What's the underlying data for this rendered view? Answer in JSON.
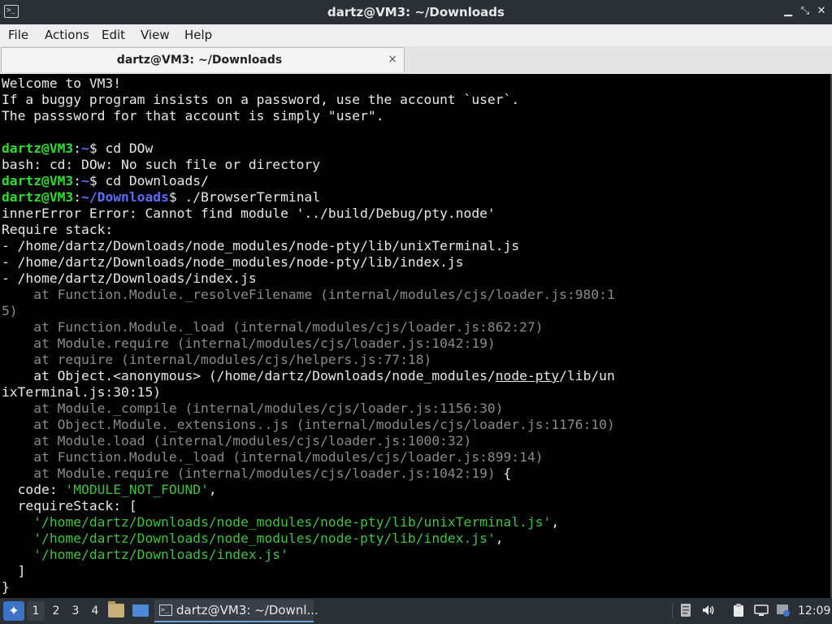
{
  "window": {
    "title": "dartz@VM3: ~/Downloads",
    "icon": "terminal-icon",
    "minimize_glyph": "▁",
    "maximize_glyph": "⤡",
    "close_glyph": "✕"
  },
  "menu": {
    "file": "File",
    "actions": "Actions",
    "edit": "Edit",
    "view": "View",
    "help": "Help"
  },
  "tab": {
    "label": "dartz@VM3: ~/Downloads",
    "close_glyph": "×"
  },
  "terminal": {
    "colors": {
      "prompt_user": "#2edc2e",
      "prompt_path": "#5c6cff",
      "text": "#e8e8e8",
      "dim": "#8a8a8a",
      "string": "#3ec33e"
    },
    "lines": [
      [
        {
          "t": "Welcome to VM3!",
          "c": "white"
        }
      ],
      [
        {
          "t": "If a buggy program insists on a password, use the account `user`.",
          "c": "white"
        }
      ],
      [
        {
          "t": "The passsword for that account is simply \"user\".",
          "c": "white"
        }
      ],
      [
        {
          "t": "",
          "c": "white"
        }
      ],
      [
        {
          "t": "dartz@VM3",
          "c": "green"
        },
        {
          "t": ":",
          "c": "white"
        },
        {
          "t": "~",
          "c": "blue"
        },
        {
          "t": "$ cd DOw",
          "c": "white"
        }
      ],
      [
        {
          "t": "bash: cd: DOw: No such file or directory",
          "c": "white"
        }
      ],
      [
        {
          "t": "dartz@VM3",
          "c": "green"
        },
        {
          "t": ":",
          "c": "white"
        },
        {
          "t": "~",
          "c": "blue"
        },
        {
          "t": "$ cd Downloads/",
          "c": "white"
        }
      ],
      [
        {
          "t": "dartz@VM3",
          "c": "green"
        },
        {
          "t": ":",
          "c": "white"
        },
        {
          "t": "~/Downloads",
          "c": "blue"
        },
        {
          "t": "$ ./BrowserTerminal",
          "c": "white"
        }
      ],
      [
        {
          "t": "innerError Error: Cannot find module '../build/Debug/pty.node'",
          "c": "white"
        }
      ],
      [
        {
          "t": "Require stack:",
          "c": "white"
        }
      ],
      [
        {
          "t": "- /home/dartz/Downloads/node_modules/node-pty/lib/unixTerminal.js",
          "c": "white"
        }
      ],
      [
        {
          "t": "- /home/dartz/Downloads/node_modules/node-pty/lib/index.js",
          "c": "white"
        }
      ],
      [
        {
          "t": "- /home/dartz/Downloads/index.js",
          "c": "white"
        }
      ],
      [
        {
          "t": "    at Function.Module._resolveFilename (internal/modules/cjs/loader.js:980:1",
          "c": "gray"
        }
      ],
      [
        {
          "t": "5)",
          "c": "gray"
        }
      ],
      [
        {
          "t": "    at Function.Module._load (internal/modules/cjs/loader.js:862:27)",
          "c": "gray"
        }
      ],
      [
        {
          "t": "    at Module.require (internal/modules/cjs/loader.js:1042:19)",
          "c": "gray"
        }
      ],
      [
        {
          "t": "    at require (internal/modules/cjs/helpers.js:77:18)",
          "c": "gray"
        }
      ],
      [
        {
          "t": "    at Object.<anonymous> (/home/dartz/Downloads/node_modules/",
          "c": "white"
        },
        {
          "t": "node-pty",
          "c": "white",
          "u": true
        },
        {
          "t": "/lib/un",
          "c": "white"
        }
      ],
      [
        {
          "t": "ixTerminal.js:30:15)",
          "c": "white"
        }
      ],
      [
        {
          "t": "    at Module._compile (internal/modules/cjs/loader.js:1156:30)",
          "c": "gray"
        }
      ],
      [
        {
          "t": "    at Object.Module._extensions..js (internal/modules/cjs/loader.js:1176:10)",
          "c": "gray"
        }
      ],
      [
        {
          "t": "    at Module.load (internal/modules/cjs/loader.js:1000:32)",
          "c": "gray"
        }
      ],
      [
        {
          "t": "    at Function.Module._load (internal/modules/cjs/loader.js:899:14)",
          "c": "gray"
        }
      ],
      [
        {
          "t": "    at Module.require (internal/modules/cjs/loader.js:1042:19)",
          "c": "gray"
        },
        {
          "t": " {",
          "c": "white"
        }
      ],
      [
        {
          "t": "  code: ",
          "c": "white"
        },
        {
          "t": "'MODULE_NOT_FOUND'",
          "c": "str"
        },
        {
          "t": ",",
          "c": "white"
        }
      ],
      [
        {
          "t": "  requireStack: [",
          "c": "white"
        }
      ],
      [
        {
          "t": "    ",
          "c": "white"
        },
        {
          "t": "'/home/dartz/Downloads/node_modules/node-pty/lib/unixTerminal.js'",
          "c": "str"
        },
        {
          "t": ",",
          "c": "white"
        }
      ],
      [
        {
          "t": "    ",
          "c": "white"
        },
        {
          "t": "'/home/dartz/Downloads/node_modules/node-pty/lib/index.js'",
          "c": "str"
        },
        {
          "t": ",",
          "c": "white"
        }
      ],
      [
        {
          "t": "    ",
          "c": "white"
        },
        {
          "t": "'/home/dartz/Downloads/index.js'",
          "c": "str"
        }
      ],
      [
        {
          "t": "  ]",
          "c": "white"
        }
      ],
      [
        {
          "t": "}",
          "c": "white"
        }
      ]
    ]
  },
  "taskbar": {
    "start_icon": "start-menu-icon",
    "start_glyph": "✦",
    "workspaces": [
      "1",
      "2",
      "3",
      "4"
    ],
    "active_workspace": "1",
    "task_label": "dartz@VM3: ~/Downl...",
    "tray": {
      "volume_glyph": "🔊",
      "network_glyph": "⊞"
    },
    "clock": "12:09"
  }
}
